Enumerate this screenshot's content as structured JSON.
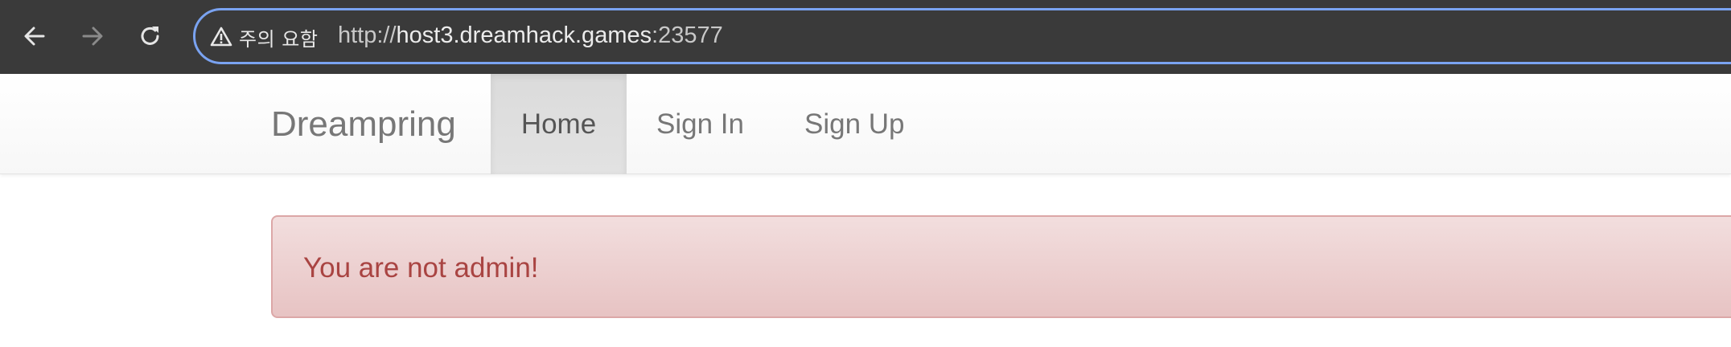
{
  "browser": {
    "security_label": "주의 요함",
    "url": {
      "scheme": "http://",
      "host": "host3.dreamhack.games",
      "port": ":23577"
    },
    "icons": {
      "back": "arrow-left-icon",
      "forward": "arrow-right-icon",
      "reload": "reload-icon",
      "warning": "warning-triangle-icon"
    }
  },
  "navbar": {
    "brand": "Dreampring",
    "links": [
      {
        "label": "Home",
        "active": true
      },
      {
        "label": "Sign In",
        "active": false
      },
      {
        "label": "Sign Up",
        "active": false
      }
    ]
  },
  "alert": {
    "type": "danger",
    "message": "You are not admin!"
  },
  "colors": {
    "browser_bar": "#3a3a3a",
    "omnibox_border": "#7aa3f1",
    "alert_text": "#a94442",
    "alert_border": "#dca7a7",
    "alert_bg": "#f2dede",
    "navbar_text": "#777777",
    "active_tab_bg": "#dddddd"
  }
}
